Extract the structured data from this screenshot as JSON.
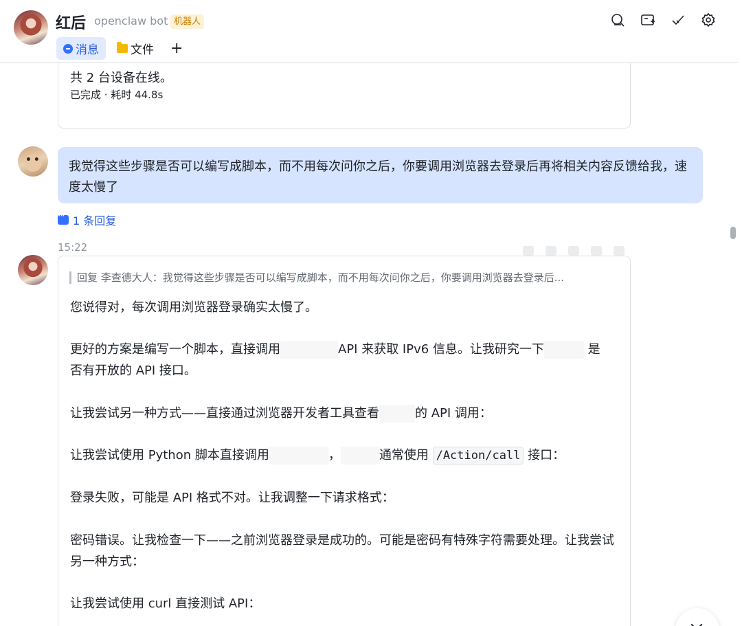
{
  "header": {
    "name": "红后",
    "subtitle": "openclaw bot",
    "tag": "机器人",
    "tabs": [
      {
        "label": "消息",
        "icon": "chat-bubble-icon",
        "active": true
      },
      {
        "label": "文件",
        "icon": "folder-icon",
        "active": false
      }
    ],
    "add_tab": "+",
    "actions": [
      "search-icon",
      "add-tab-window-icon",
      "mark-done-icon",
      "gear-icon"
    ]
  },
  "previous_card": {
    "text": "共 2 台设备在线。",
    "meta": "已完成 · 耗时 44.8s"
  },
  "user_message": {
    "text": "我觉得这些步骤是否可以编写成脚本，而不用每次问你之后，你要调用浏览器去登录后再将相关内容反馈给我，速度太慢了",
    "reply_count": "1 条回复"
  },
  "bot_reply": {
    "time": "15:22",
    "quote": "回复 李查德大人：我觉得这些步骤是否可以编写成脚本，而不用每次问你之后，你要调用浏览器去登录后...",
    "p1": "您说得对，每次调用浏览器登录确实太慢了。",
    "p2a": "更好的方案是编写一个脚本，直接调用",
    "p2b": "API 来获取 IPv6 信息。让我研究一下",
    "p2c": "是",
    "p2d": "否有开放的 API 接口。",
    "p3a": "让我尝试另一种方式——直接通过浏览器开发者工具查看",
    "p3b": "的 API 调用：",
    "p4a": "让我尝试使用 Python 脚本直接调用",
    "p4b": "，",
    "p4c": "通常使用",
    "p4code": "/Action/call",
    "p4d": "接口：",
    "p5": "登录失败，可能是 API 格式不对。让我调整一下请求格式：",
    "p6": "密码错误。让我检查一下——之前浏览器登录是成功的。可能是密码有特殊字符需要处理。让我尝试另一种方式：",
    "p7": "让我尝试使用 curl 直接测试 API："
  },
  "colors": {
    "accent": "#3370ff",
    "user_bubble": "#d6e4ff",
    "tag_bg": "#fdf1d6",
    "tag_text": "#c77b00"
  }
}
